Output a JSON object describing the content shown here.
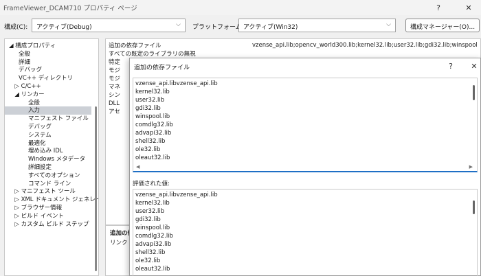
{
  "window": {
    "title": "FrameViewer_DCAM710 プロパティ ページ",
    "help_glyph": "?",
    "close_glyph": "✕"
  },
  "config_bar": {
    "config_label": "構成(C):",
    "config_value": "アクティブ(Debug)",
    "platform_label": "プラットフォーム(P):",
    "platform_value": "アクティブ(Win32)",
    "manager_button": "構成マネージャー(O)...",
    "chevron_glyph": "⌵"
  },
  "tree": {
    "items": [
      {
        "label": "◢ 構成プロパティ",
        "indent": 0
      },
      {
        "label": "全般",
        "indent": 1
      },
      {
        "label": "詳細",
        "indent": 1
      },
      {
        "label": "デバッグ",
        "indent": 1
      },
      {
        "label": "VC++ ディレクトリ",
        "indent": 1
      },
      {
        "label": "▷ C/C++",
        "indent": 0.6
      },
      {
        "label": "◢ リンカー",
        "indent": 0.6
      },
      {
        "label": "全般",
        "indent": 2
      },
      {
        "label": "入力",
        "indent": 2,
        "selected": true
      },
      {
        "label": "マニフェスト ファイル",
        "indent": 2
      },
      {
        "label": "デバッグ",
        "indent": 2
      },
      {
        "label": "システム",
        "indent": 2
      },
      {
        "label": "最適化",
        "indent": 2
      },
      {
        "label": "埋め込み IDL",
        "indent": 2
      },
      {
        "label": "Windows メタデータ",
        "indent": 2
      },
      {
        "label": "詳細設定",
        "indent": 2
      },
      {
        "label": "すべてのオプション",
        "indent": 2
      },
      {
        "label": "コマンド ライン",
        "indent": 2
      },
      {
        "label": "▷ マニフェスト ツール",
        "indent": 0.6
      },
      {
        "label": "▷ XML ドキュメント ジェネレータ",
        "indent": 0.6
      },
      {
        "label": "▷ ブラウザー情報",
        "indent": 0.6
      },
      {
        "label": "▷ ビルド イベント",
        "indent": 0.6
      },
      {
        "label": "▷ カスタム ビルド ステップ",
        "indent": 0.6
      }
    ]
  },
  "properties": {
    "rows": [
      "追加の依存ファイル",
      "すべての既定のライブラリの無視",
      "特定",
      "モジ",
      "モジ",
      "マネ",
      "シン",
      "DLL",
      "アセ"
    ],
    "first_value": "vzense_api.lib;opencv_world300.lib;kernel32.lib;user32.lib;gdi32.lib;winspool"
  },
  "description": {
    "title": "追加の依",
    "text": "リンク コ"
  },
  "dialog": {
    "title": "追加の依存ファイル",
    "help_glyph": "?",
    "close_glyph": "✕",
    "edit_lines": [
      "vzense_api.libvzense_api.lib",
      "kernel32.lib",
      "user32.lib",
      "gdi32.lib",
      "winspool.lib",
      "comdlg32.lib",
      "advapi32.lib",
      "shell32.lib",
      "ole32.lib",
      "oleaut32.lib"
    ],
    "evaluated_label": "評価された値:",
    "evaluated_lines": [
      "vzense_api.libvzense_api.lib",
      "kernel32.lib",
      "user32.lib",
      "gdi32.lib",
      "winspool.lib",
      "comdlg32.lib",
      "advapi32.lib",
      "shell32.lib",
      "ole32.lib",
      "oleaut32.lib"
    ],
    "scroll_left_glyph": "◀",
    "scroll_right_glyph": "▶"
  }
}
